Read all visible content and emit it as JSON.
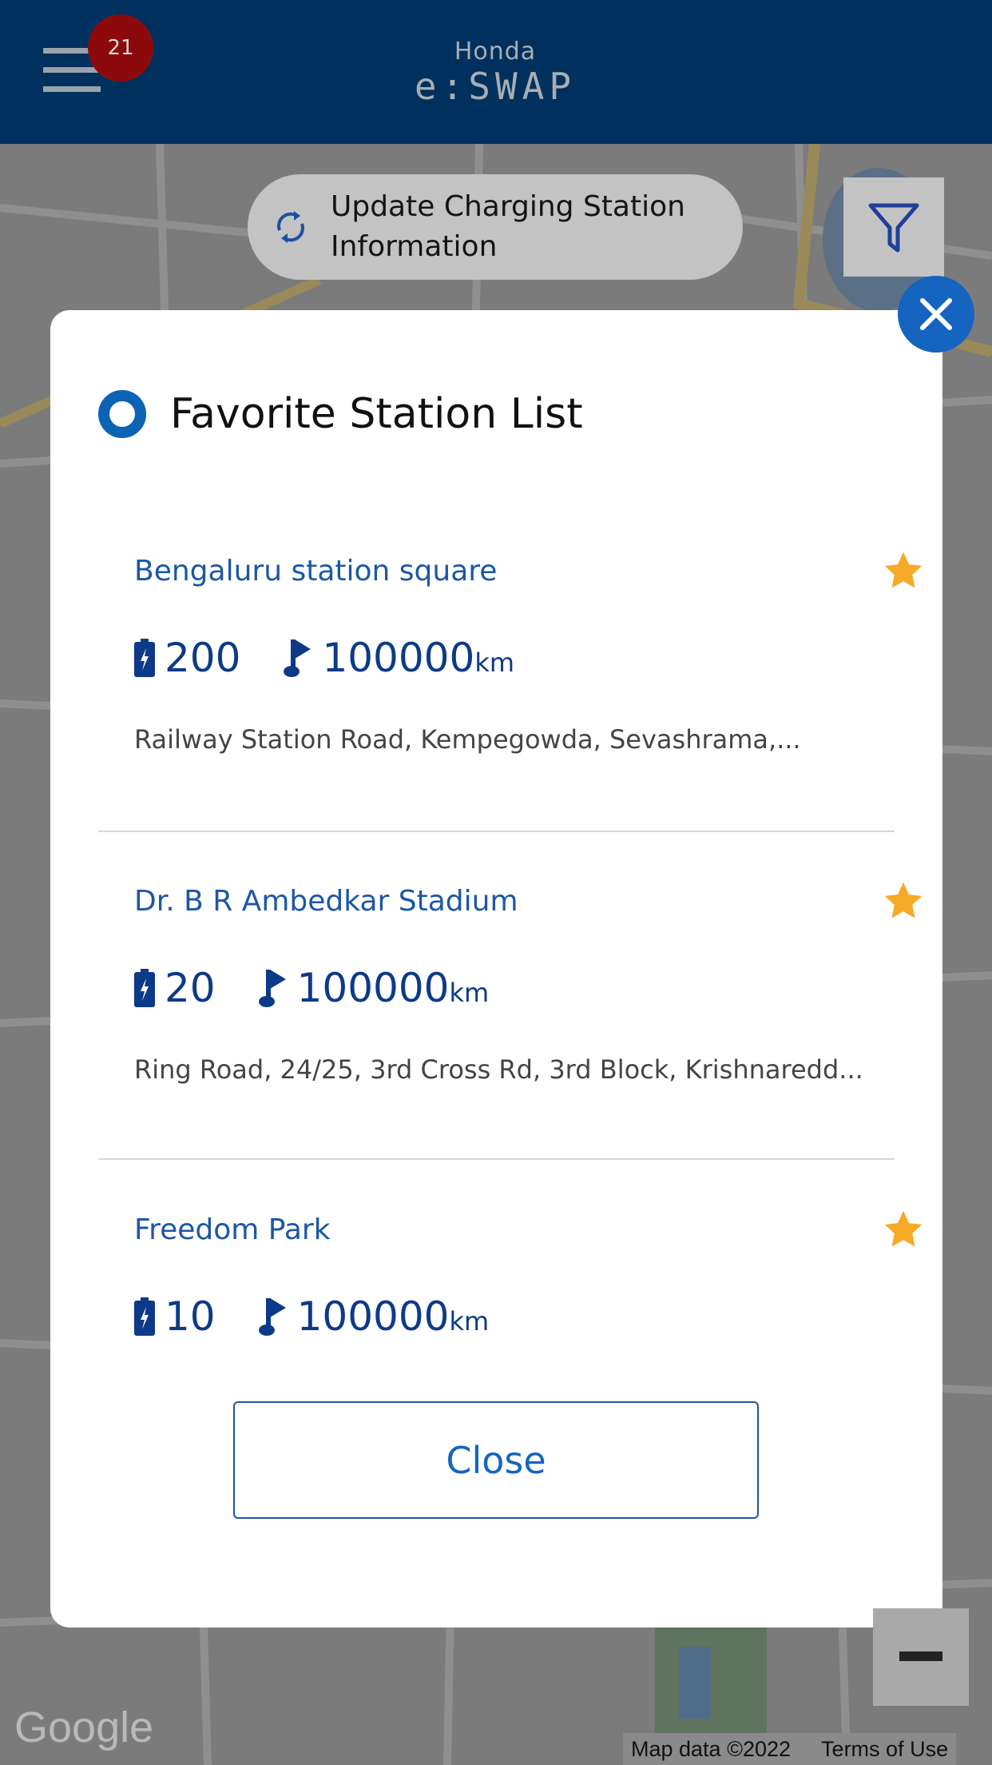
{
  "header": {
    "notification_count": "21",
    "logo_line1": "Honda",
    "logo_line2": "e:SWAP",
    "brand_color": "#00305d"
  },
  "map": {
    "update_button": "Update Charging Station Information",
    "update_line1": "Update Charging Station",
    "update_line2": "Information",
    "google_logo": "Google",
    "map_data": "Map data ©2022",
    "terms": "Terms of Use"
  },
  "modal": {
    "title": "Favorite Station List",
    "stations": [
      {
        "name": "Bengaluru station square",
        "batteries": "200",
        "distance": "100000",
        "unit": "km",
        "address": "Railway Station Road, Kempegowda, Sevashrama,...",
        "favorite": true
      },
      {
        "name": "Dr. B R Ambedkar Stadium",
        "batteries": "20",
        "distance": "100000",
        "unit": "km",
        "address": "Ring Road, 24/25, 3rd Cross Rd, 3rd Block, Krishnaredd...",
        "favorite": true
      },
      {
        "name": "Freedom Park",
        "batteries": "10",
        "distance": "100000",
        "unit": "km",
        "favorite": true
      }
    ],
    "close_label": "Close",
    "accent": "#1565c0",
    "star_color": "#f7a928"
  }
}
